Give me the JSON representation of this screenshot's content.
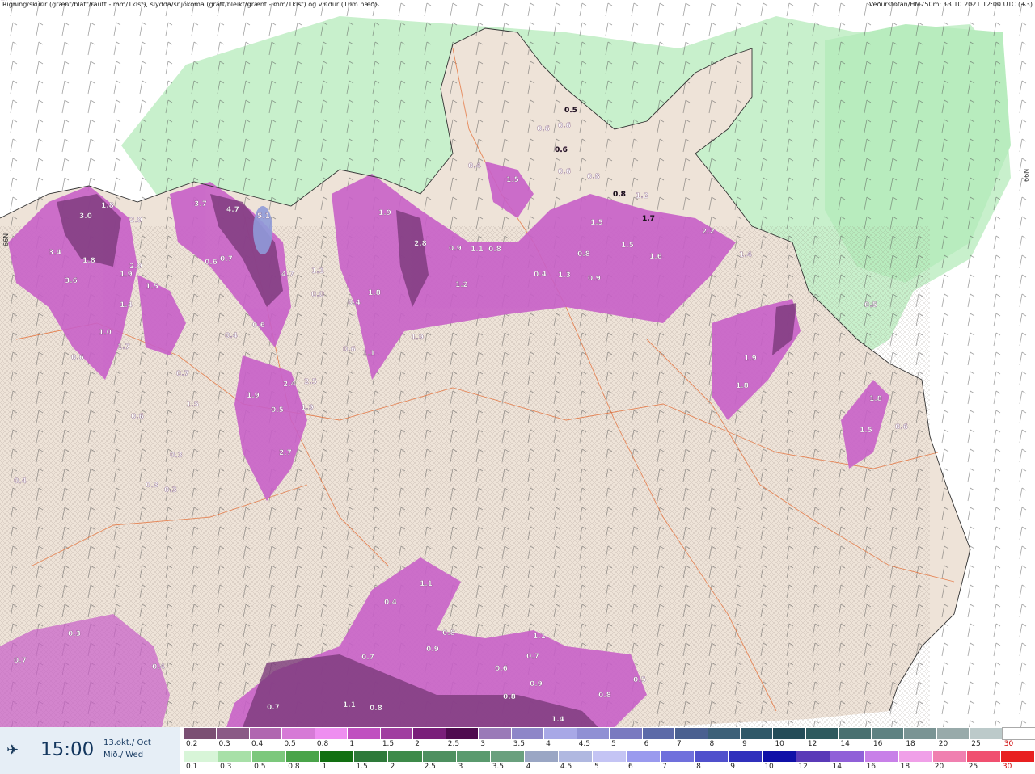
{
  "header": {
    "left": "Rigning/skúrir (grænt/blátt/rautt - mm/1klst), slydda/snjókoma (grátt/bleikt/grænt - mm/1klst) og vindur (10m hæð)",
    "right": "Veðurstofan/HM750m: 13.10.2021 12:00 UTC (+3)"
  },
  "footer": {
    "time": "15:00",
    "date_line1": "13.okt./ Oct",
    "date_line2": "Mið./ Wed"
  },
  "legend_snow": {
    "labels": [
      "0.2",
      "0.3",
      "0.4",
      "0.5",
      "0.8",
      "1",
      "1.5",
      "2",
      "2.5",
      "3",
      "3.5",
      "4",
      "4.5",
      "5",
      "6",
      "7",
      "8",
      "9",
      "10",
      "12",
      "14",
      "16",
      "18",
      "20",
      "25",
      "30"
    ],
    "colors": [
      "#7b4f73",
      "#8a5a86",
      "#b066b0",
      "#d67ad6",
      "#ee8ef0",
      "#c050c0",
      "#a03ea0",
      "#7a1e7a",
      "#4f0a4f",
      "#9a7ab8",
      "#8e86c8",
      "#a8a8e6",
      "#9090d4",
      "#7a7ac0",
      "#5c6aa8",
      "#4a6090",
      "#3c6078",
      "#2f5868",
      "#244c58",
      "#2e5a5e",
      "#487070",
      "#5e8282",
      "#7a9494",
      "#98aaaa",
      "#bccaca",
      "#ffffff"
    ]
  },
  "legend_rain": {
    "labels": [
      "0.1",
      "0.3",
      "0.5",
      "0.8",
      "1",
      "1.5",
      "2",
      "2.5",
      "3",
      "3.5",
      "4",
      "4.5",
      "5",
      "6",
      "7",
      "8",
      "9",
      "10",
      "12",
      "14",
      "16",
      "18",
      "20",
      "25",
      "30"
    ],
    "colors": [
      "#d8f5d8",
      "#a8e0a8",
      "#7cc87c",
      "#4aa44a",
      "#127012",
      "#2e7a3a",
      "#3e8a4a",
      "#4e9060",
      "#5a9a6e",
      "#6aa07e",
      "#9aa6c4",
      "#b0b8e0",
      "#c4c4f4",
      "#9a9aee",
      "#7070dc",
      "#5050cc",
      "#3030bc",
      "#1010a8",
      "#5a3ab8",
      "#9060d8",
      "#c880e8",
      "#f0a0e8",
      "#f080b0",
      "#f05070",
      "#e82020"
    ]
  },
  "precip_labels": [
    {
      "t": "3.0"
    },
    {
      "t": "1.8"
    },
    {
      "t": "2.9"
    },
    {
      "t": "2.9"
    },
    {
      "t": "3.4"
    },
    {
      "t": "1.8"
    },
    {
      "t": "3.6"
    },
    {
      "t": "1.9"
    },
    {
      "t": "1.5"
    },
    {
      "t": "1.4"
    },
    {
      "t": "1.0"
    },
    {
      "t": "1.7"
    },
    {
      "t": "0.6"
    },
    {
      "t": "0.7"
    },
    {
      "t": "1.5"
    },
    {
      "t": "0.6"
    },
    {
      "t": "0.3"
    },
    {
      "t": "0.3"
    },
    {
      "t": "0.3"
    },
    {
      "t": "0.4"
    },
    {
      "t": "3.7"
    },
    {
      "t": "4.7"
    },
    {
      "t": "5.1"
    },
    {
      "t": "0.6"
    },
    {
      "t": "0.7"
    },
    {
      "t": "4.7"
    },
    {
      "t": "1.1"
    },
    {
      "t": "0.0"
    },
    {
      "t": "0.4"
    },
    {
      "t": "0.6"
    },
    {
      "t": "2.4"
    },
    {
      "t": "1.9"
    },
    {
      "t": "1.9"
    },
    {
      "t": "0.5"
    },
    {
      "t": "2.7"
    },
    {
      "t": "2.5"
    },
    {
      "t": "1.9"
    },
    {
      "t": "2.8"
    },
    {
      "t": "0.9"
    },
    {
      "t": "1.1"
    },
    {
      "t": "0.8"
    },
    {
      "t": "1.2"
    },
    {
      "t": "1.8"
    },
    {
      "t": "0.4"
    },
    {
      "t": "0.4"
    },
    {
      "t": "0.6"
    },
    {
      "t": "1.1"
    },
    {
      "t": "1.9"
    },
    {
      "t": "0.5"
    },
    {
      "t": "0.6"
    },
    {
      "t": "0.6"
    },
    {
      "t": "0.6"
    },
    {
      "t": "0.6"
    },
    {
      "t": "0.8"
    },
    {
      "t": "0.8"
    },
    {
      "t": "1.2"
    },
    {
      "t": "1.5"
    },
    {
      "t": "1.7"
    },
    {
      "t": "1.5"
    },
    {
      "t": "1.6"
    },
    {
      "t": "2.2"
    },
    {
      "t": "0.8"
    },
    {
      "t": "1.3"
    },
    {
      "t": "0.9"
    },
    {
      "t": "0.4"
    },
    {
      "t": "1.5"
    },
    {
      "t": "1.4"
    },
    {
      "t": "1.9"
    },
    {
      "t": "1.8"
    },
    {
      "t": "0.5"
    },
    {
      "t": "1.8"
    },
    {
      "t": "1.5"
    },
    {
      "t": "0.6"
    },
    {
      "t": "1.1"
    },
    {
      "t": "0.4"
    },
    {
      "t": "0.8"
    },
    {
      "t": "0.9"
    },
    {
      "t": "0.7"
    },
    {
      "t": "1.1"
    },
    {
      "t": "0.7"
    },
    {
      "t": "0.6"
    },
    {
      "t": "0.8"
    },
    {
      "t": "0.9"
    },
    {
      "t": "0.8"
    },
    {
      "t": "0.5"
    },
    {
      "t": "0.7"
    },
    {
      "t": "1.1"
    },
    {
      "t": "0.8"
    },
    {
      "t": "1.4"
    },
    {
      "t": "0.3"
    },
    {
      "t": "0.7"
    },
    {
      "t": "0.4"
    },
    {
      "t": "1.4"
    }
  ]
}
